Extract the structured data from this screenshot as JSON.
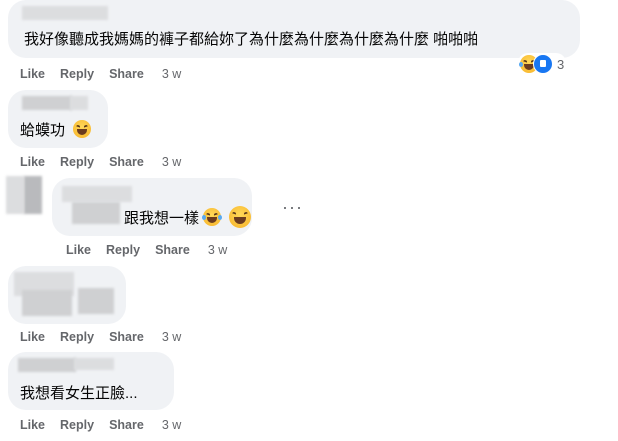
{
  "comments": [
    {
      "text": "我好像聽成我媽媽的褲子都給妳了為什麼為什麼為什麼為什麼 啪啪啪",
      "reaction_count": "3",
      "actions": {
        "like": "Like",
        "reply": "Reply",
        "share": "Share",
        "time": "3 w"
      }
    },
    {
      "text": "蛤蟆功",
      "actions": {
        "like": "Like",
        "reply": "Reply",
        "share": "Share",
        "time": "3 w"
      }
    },
    {
      "text": "跟我想一樣",
      "actions": {
        "like": "Like",
        "reply": "Reply",
        "share": "Share",
        "time": "3 w"
      }
    },
    {
      "text": "",
      "actions": {
        "like": "Like",
        "reply": "Reply",
        "share": "Share",
        "time": "3 w"
      }
    },
    {
      "text": "我想看女生正臉...",
      "actions": {
        "like": "Like",
        "reply": "Reply",
        "share": "Share",
        "time": "3 w"
      }
    }
  ],
  "more_label": "···",
  "colors": {
    "bubble": "#f0f2f5",
    "meta": "#65676b",
    "like_blue": "#1877f2"
  },
  "icons": [
    "laughing-emoji-icon",
    "like-reaction-icon",
    "more-options-icon"
  ]
}
